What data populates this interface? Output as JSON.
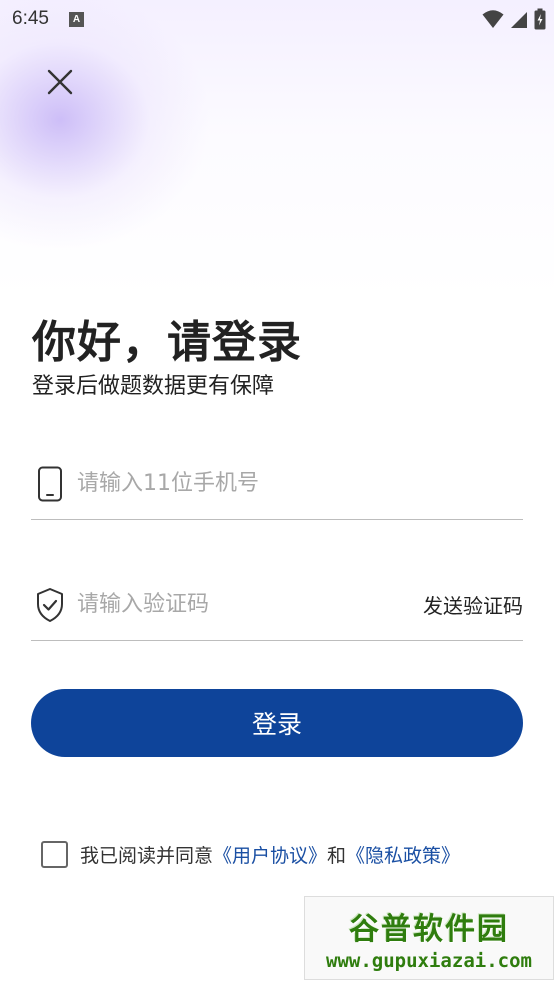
{
  "status_bar": {
    "time": "6:45",
    "notification_badge": "A"
  },
  "header": {
    "title": "你好，请登录",
    "subtitle": "登录后做题数据更有保障"
  },
  "form": {
    "phone_placeholder": "请输入11位手机号",
    "phone_value": "",
    "code_placeholder": "请输入验证码",
    "code_value": "",
    "send_code_label": "发送验证码",
    "login_label": "登录"
  },
  "agreement": {
    "checked": false,
    "prefix": "我已阅读并同意",
    "user_agreement": "《用户协议》",
    "and": "和",
    "privacy_policy": "《隐私政策》"
  },
  "watermark": {
    "title": "谷普软件园",
    "url": "www.gupuxiazai.com"
  },
  "colors": {
    "primary": "#0e449a",
    "link": "#1a4fa3",
    "watermark": "#2f7d0e"
  }
}
